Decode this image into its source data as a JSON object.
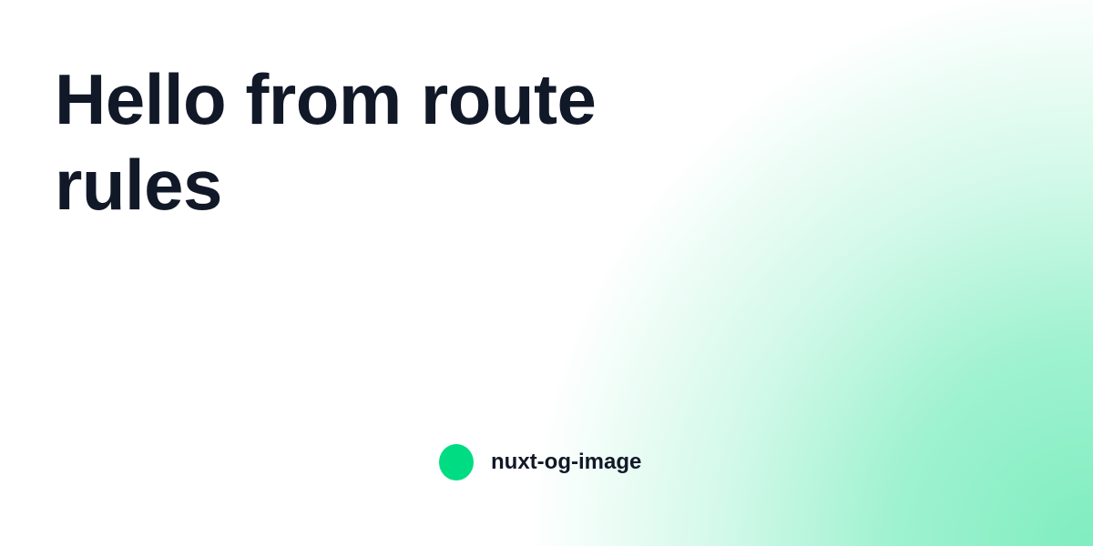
{
  "title": "Hello from route rules",
  "brand": {
    "name": "nuxt-og-image",
    "icon": "green-circle-logo-icon"
  },
  "colors": {
    "text": "#111827",
    "accent": "#00dc82",
    "background": "#ffffff"
  }
}
